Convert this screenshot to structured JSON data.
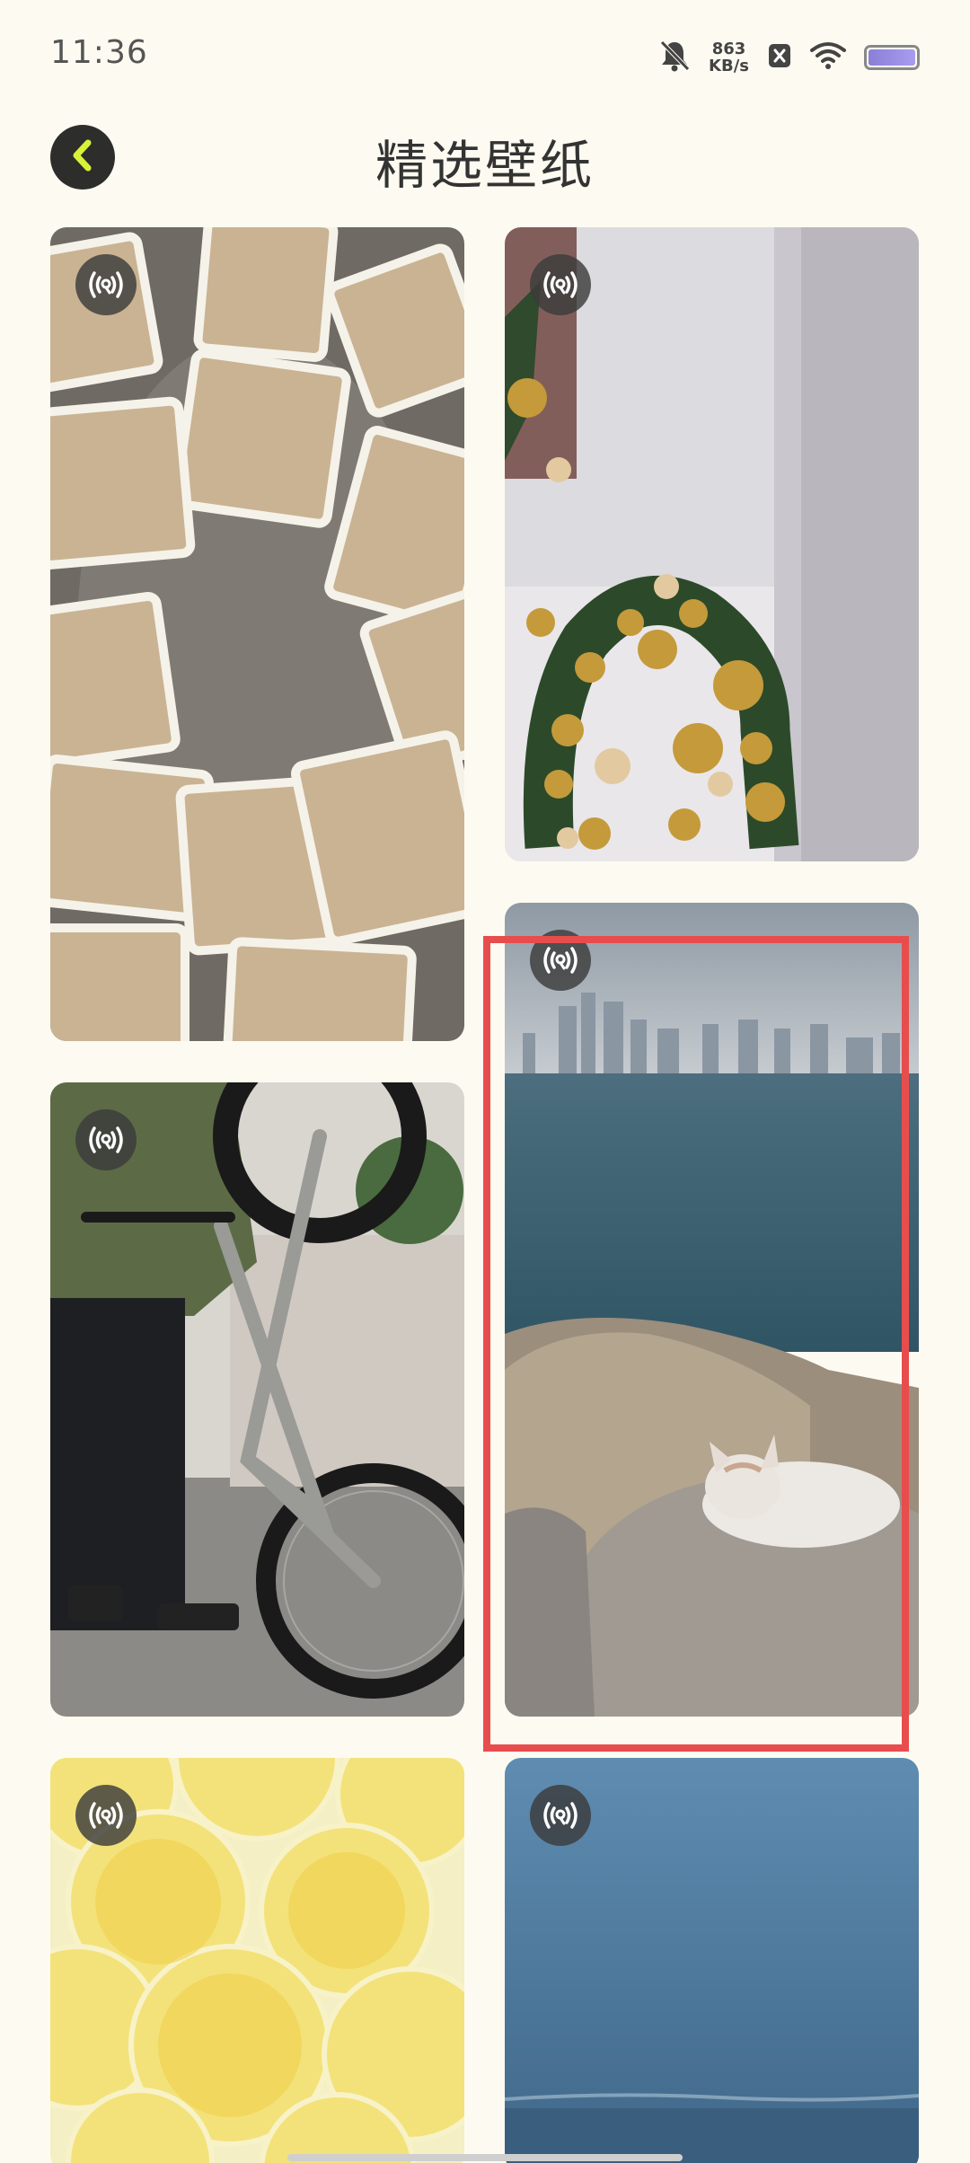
{
  "status_bar": {
    "time": "11:36",
    "net_speed_value": "863",
    "net_speed_unit": "KB/s",
    "icons": [
      "bell-muted-icon",
      "close-box-icon",
      "wifi-icon",
      "battery-icon"
    ]
  },
  "header": {
    "title": "精选壁纸",
    "back_icon": "chevron-left-icon",
    "accent_color": "#d8f23a"
  },
  "wallpapers": [
    {
      "subject": "paper-cups",
      "live_icon": "live-broadcast-icon"
    },
    {
      "subject": "christmas-wreath",
      "live_icon": "live-broadcast-icon"
    },
    {
      "subject": "bmx-bike",
      "live_icon": "live-broadcast-icon"
    },
    {
      "subject": "cat-on-rocks-city-skyline",
      "live_icon": "live-broadcast-icon"
    },
    {
      "subject": "lemon-slices",
      "live_icon": "live-broadcast-icon"
    },
    {
      "subject": "blue-sea-sky",
      "live_icon": "live-broadcast-icon"
    }
  ],
  "colors": {
    "background": "#fdfbf1",
    "highlight": "#e84d4d"
  }
}
